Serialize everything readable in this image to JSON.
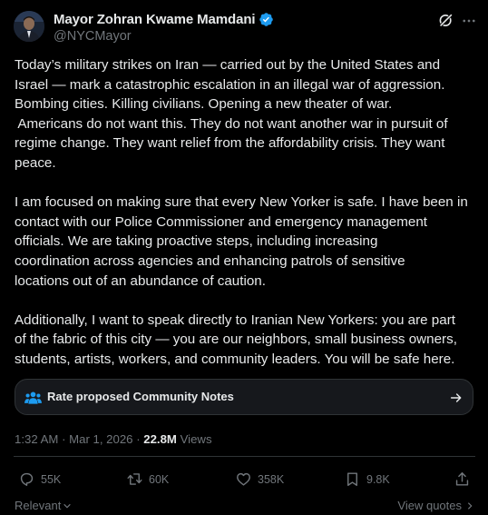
{
  "post": {
    "author": {
      "display_name": "Mayor Zohran Kwame Mamdani",
      "handle": "@NYCMayor",
      "verified": true
    },
    "icons": {
      "grok": "grok-icon",
      "more": "more-icon",
      "verified": "verified-badge-icon"
    },
    "paragraphs": [
      {
        "lines": [
          "Today’s military strikes on Iran — carried out by the United States and",
          "Israel — mark a catastrophic escalation in an illegal war of aggression.",
          "Bombing cities. Killing civilians. Opening a new theater of war.",
          " Americans do not want this. They do not want another war in pursuit of",
          "regime change. They want relief from the affordability crisis. They want",
          "peace."
        ]
      },
      {
        "lines": [
          "I am focused on making sure that every New Yorker is safe. I have been in",
          "contact with our Police Commissioner and emergency management",
          "officials. We are taking proactive steps, including increasing",
          "coordination across agencies and enhancing patrols of sensitive",
          "locations out of an abundance of caution."
        ]
      },
      {
        "lines": [
          "Additionally, I want to speak directly to Iranian New Yorkers: you are part",
          "of the fabric of this city — you are our neighbors, small business owners,",
          "students, artists, workers, and community leaders. You will be safe here."
        ]
      }
    ],
    "community_notes": {
      "label": "Rate proposed Community Notes"
    },
    "meta": {
      "time": "1:32 AM",
      "separator": "·",
      "date": "Mar 1, 2026",
      "views_count": "22.8M",
      "views_label": "Views"
    },
    "actions": {
      "replies": "55K",
      "reposts": "60K",
      "likes": "358K",
      "views": "9.8K"
    },
    "footer": {
      "sort_label": "Relevant",
      "view_quotes": "View quotes"
    }
  },
  "colors": {
    "background": "#000000",
    "text_primary": "#e7e9ea",
    "text_secondary": "#71767b",
    "verified_blue": "#1d9bf0",
    "border": "#2f3336",
    "card_background": "#16181c"
  }
}
